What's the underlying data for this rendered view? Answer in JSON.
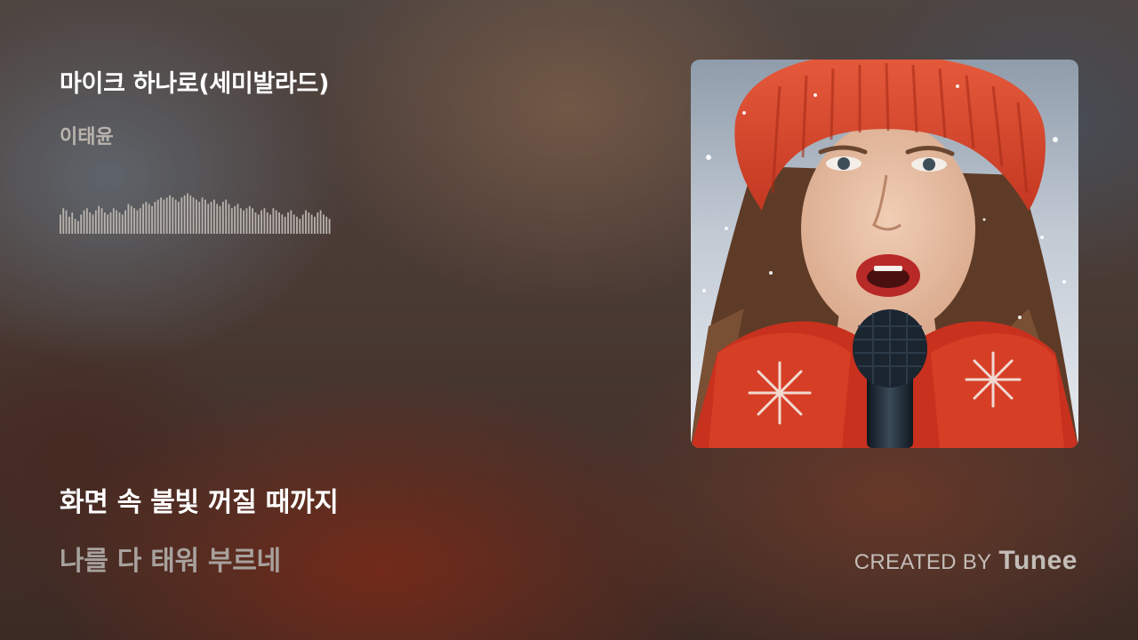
{
  "track": {
    "title": "마이크 하나로(세미발라드)",
    "artist": "이태윤"
  },
  "lyrics": {
    "current": "화면 속 불빛 꺼질 때까지",
    "next": "나를 다 태워 부르네"
  },
  "credit": {
    "prefix": "CREATED BY",
    "brand": "Tunee"
  },
  "waveform": {
    "color": "#b8b2ad",
    "levels": [
      0.45,
      0.6,
      0.55,
      0.4,
      0.5,
      0.35,
      0.3,
      0.45,
      0.55,
      0.6,
      0.5,
      0.45,
      0.55,
      0.65,
      0.6,
      0.5,
      0.45,
      0.5,
      0.6,
      0.55,
      0.5,
      0.45,
      0.55,
      0.7,
      0.65,
      0.6,
      0.55,
      0.6,
      0.7,
      0.75,
      0.7,
      0.65,
      0.75,
      0.8,
      0.85,
      0.8,
      0.85,
      0.9,
      0.85,
      0.8,
      0.75,
      0.85,
      0.9,
      0.95,
      0.9,
      0.85,
      0.8,
      0.75,
      0.85,
      0.8,
      0.7,
      0.75,
      0.8,
      0.7,
      0.65,
      0.75,
      0.8,
      0.7,
      0.6,
      0.65,
      0.7,
      0.6,
      0.55,
      0.6,
      0.65,
      0.6,
      0.5,
      0.45,
      0.55,
      0.6,
      0.5,
      0.45,
      0.6,
      0.55,
      0.5,
      0.45,
      0.4,
      0.5,
      0.55,
      0.45,
      0.4,
      0.35,
      0.45,
      0.55,
      0.5,
      0.45,
      0.4,
      0.5,
      0.55,
      0.45,
      0.4,
      0.35
    ]
  },
  "album_art": {
    "icon": "singer-portrait-icon",
    "colors": {
      "sky": "#aab4c0",
      "snow": "#e4e8ee",
      "hat": "#d8432a",
      "scarf": "#c8311e",
      "hair": "#5a3a26",
      "skin": "#e8c0a4",
      "mic": "#1c2630"
    }
  }
}
